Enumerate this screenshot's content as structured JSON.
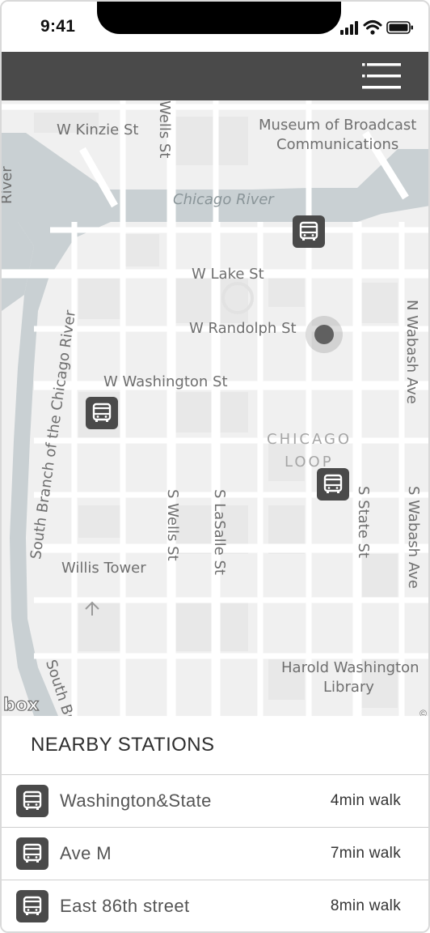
{
  "status_bar": {
    "time": "9:41"
  },
  "header": {
    "menu_icon": "hamburger-menu-icon"
  },
  "map": {
    "labels": {
      "kinzie": "W Kinzie St",
      "museum_line1": "Museum of Broadcast",
      "museum_line2": "Communications",
      "chicago_river": "Chicago River",
      "river_left": "River",
      "wells_top": "Wells St",
      "lake": "W Lake St",
      "randolph": "W Randolph St",
      "wabash_n": "N Wabash Ave",
      "washington": "W Washington St",
      "loop_line1": "CHICAGO",
      "loop_line2": "LOOP",
      "south_branch": "South Branch of the Chicago River",
      "s_wells": "S Wells St",
      "s_lasalle": "S LaSalle St",
      "s_state": "S State St",
      "s_wabash": "S Wabash Ave",
      "willis": "Willis Tower",
      "harold_line1": "Harold Washington",
      "harold_line2": "Library",
      "south_br": "South Br",
      "logo": "box",
      "copyright": "©"
    },
    "markers_icon": "bus-icon"
  },
  "nearby": {
    "title": "NEARBY STATIONS",
    "stations": [
      {
        "name": "Washington&State",
        "walk": "4min walk"
      },
      {
        "name": "Ave M",
        "walk": "7min walk"
      },
      {
        "name": "East 86th street",
        "walk": "8min walk"
      }
    ]
  },
  "colors": {
    "header": "#4a4a4a",
    "map_background": "#f0f0f0",
    "road": "#ffffff",
    "water": "#c9d0d3",
    "marker": "#4a4a4a"
  }
}
